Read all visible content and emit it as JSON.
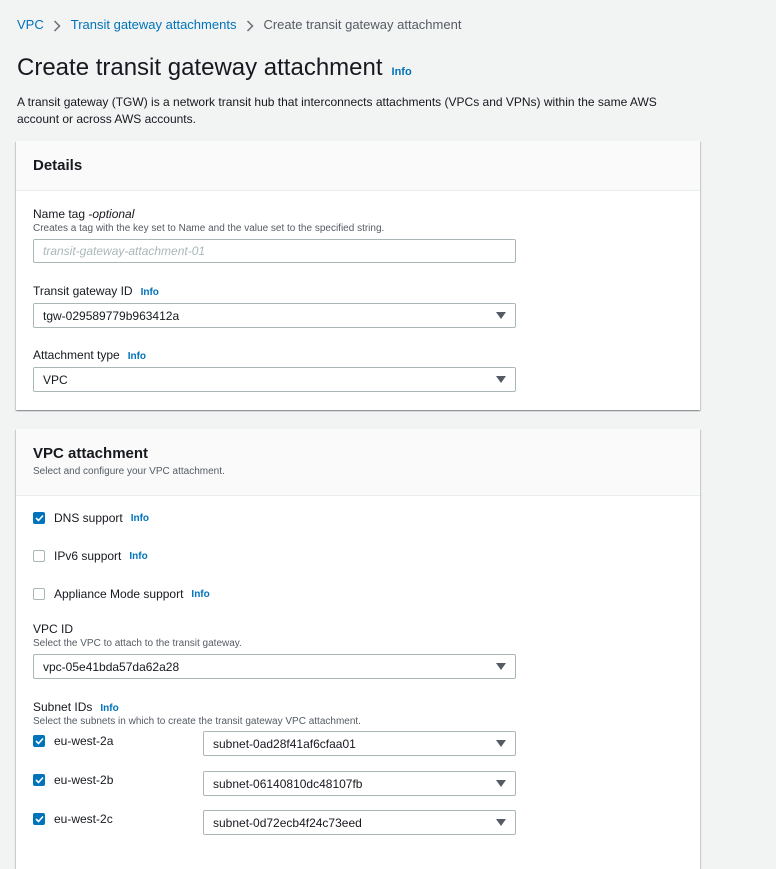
{
  "breadcrumb": {
    "items": [
      "VPC",
      "Transit gateway attachments"
    ],
    "current": "Create transit gateway attachment"
  },
  "page": {
    "title": "Create transit gateway attachment",
    "info": "Info",
    "description": "A transit gateway (TGW) is a network transit hub that interconnects attachments (VPCs and VPNs) within the same AWS account or across AWS accounts."
  },
  "details": {
    "title": "Details",
    "name_tag": {
      "label": "Name tag - ",
      "optional": "optional",
      "description": "Creates a tag with the key set to Name and the value set to the specified string.",
      "placeholder": "transit-gateway-attachment-01",
      "value": ""
    },
    "tgw_id": {
      "label": "Transit gateway ID",
      "info": "Info",
      "value": "tgw-029589779b963412a"
    },
    "attachment_type": {
      "label": "Attachment type",
      "info": "Info",
      "value": "VPC"
    }
  },
  "vpc_attachment": {
    "title": "VPC attachment",
    "subtitle": "Select and configure your VPC attachment.",
    "options": [
      {
        "label": "DNS support",
        "info": "Info",
        "checked": true
      },
      {
        "label": "IPv6 support",
        "info": "Info",
        "checked": false
      },
      {
        "label": "Appliance Mode support",
        "info": "Info",
        "checked": false
      }
    ],
    "vpc_id": {
      "label": "VPC ID",
      "description": "Select the VPC to attach to the transit gateway.",
      "value": "vpc-05e41bda57da62a28"
    },
    "subnets": {
      "label": "Subnet IDs",
      "info": "Info",
      "description": "Select the subnets in which to create the transit gateway VPC attachment.",
      "rows": [
        {
          "az": "eu-west-2a",
          "checked": true,
          "subnet": "subnet-0ad28f41af6cfaa01"
        },
        {
          "az": "eu-west-2b",
          "checked": true,
          "subnet": "subnet-06140810dc48107fb"
        },
        {
          "az": "eu-west-2c",
          "checked": true,
          "subnet": "subnet-0d72ecb4f24c73eed"
        }
      ]
    }
  }
}
